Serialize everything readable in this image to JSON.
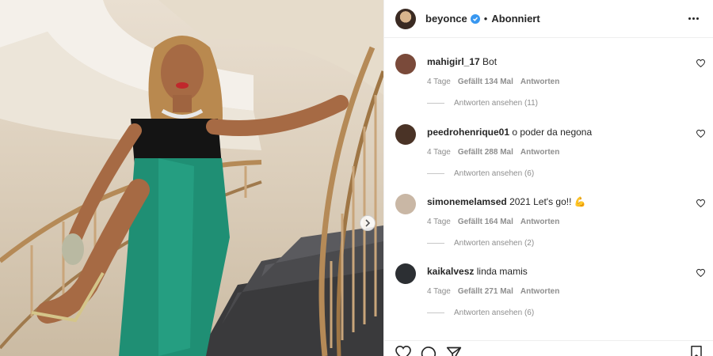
{
  "post": {
    "username": "beyonce",
    "verified": true,
    "separator": "•",
    "follow_status": "Abonniert",
    "more_icon": "more-horizontal-icon"
  },
  "comments": [
    {
      "username": "mahigirl_17",
      "text": "Bot",
      "age": "4 Tage",
      "likes": "Gefällt 134 Mal",
      "reply_label": "Antworten",
      "view_replies": "Antworten ansehen (11)",
      "avatar_color": "#7a4a3a"
    },
    {
      "username": "peedrohenrique01",
      "text": "o poder da negona",
      "age": "4 Tage",
      "likes": "Gefällt 288 Mal",
      "reply_label": "Antworten",
      "view_replies": "Antworten ansehen (6)",
      "avatar_color": "#4a3326"
    },
    {
      "username": "simonemelamsed",
      "text": "2021 Let's go!! 💪",
      "age": "4 Tage",
      "likes": "Gefällt 164 Mal",
      "reply_label": "Antworten",
      "view_replies": "Antworten ansehen (2)",
      "avatar_color": "#c9b7a5"
    },
    {
      "username": "kaikalvesz",
      "text": "linda mamis",
      "age": "4 Tage",
      "likes": "Gefällt 271 Mal",
      "reply_label": "Antworten",
      "view_replies": "Antworten ansehen (6)",
      "avatar_color": "#2c2f33"
    }
  ],
  "actions": {
    "like_icon": "heart-icon",
    "comment_icon": "comment-icon",
    "share_icon": "send-icon",
    "save_icon": "bookmark-icon"
  },
  "colors": {
    "verified_blue": "#3897f0",
    "muted_text": "#8e8e8e",
    "primary_text": "#262626",
    "dress_green": "#1f8f74"
  }
}
